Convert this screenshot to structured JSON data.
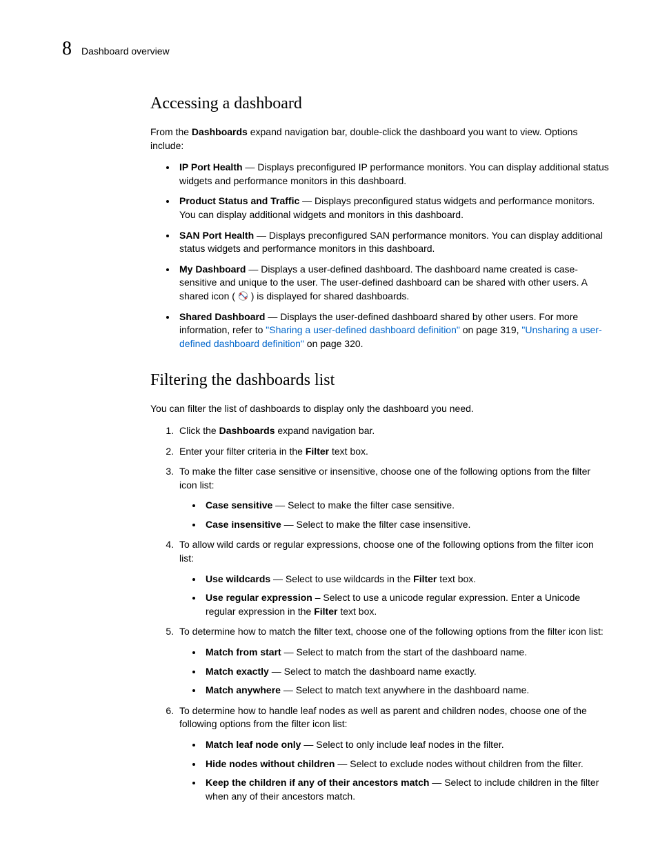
{
  "header": {
    "page_number": "8",
    "title": "Dashboard overview"
  },
  "section1": {
    "heading": "Accessing a dashboard",
    "intro_a": "From the ",
    "intro_bold": "Dashboards",
    "intro_b": " expand navigation bar, double-click the dashboard you want to view. Options include:",
    "items": [
      {
        "bold": "IP Port Health",
        "rest": " — Displays preconfigured IP performance monitors. You can display additional status widgets and performance monitors in this dashboard."
      },
      {
        "bold": "Product Status and Traffic",
        "rest": " — Displays preconfigured status widgets and performance monitors. You can display additional widgets and monitors in this dashboard."
      },
      {
        "bold": "SAN Port Health",
        "rest": " — Displays preconfigured SAN performance monitors. You can display additional status widgets and performance monitors in this dashboard."
      }
    ],
    "item4": {
      "bold": "My Dashboard",
      "rest_a": " — Displays a user-defined dashboard. The dashboard name created is case-sensitive and unique to the user. The user-defined dashboard can be shared with other users. A shared icon ( ",
      "rest_b": " ) is displayed for shared dashboards."
    },
    "item5": {
      "bold": "Shared Dashboard",
      "rest_a": " — Displays the user-defined dashboard shared by other users. For more information, refer to ",
      "link1": "\"Sharing a user-defined dashboard definition\"",
      "mid1": " on page 319, ",
      "link2": "\"Unsharing a user-defined dashboard definition\"",
      "rest_b": " on page 320."
    }
  },
  "section2": {
    "heading": "Filtering the dashboards list",
    "intro": "You can filter the list of dashboards to display only the dashboard you need.",
    "step1": {
      "a": "Click the ",
      "bold": "Dashboards",
      "b": " expand navigation bar."
    },
    "step2": {
      "a": "Enter your filter criteria in the ",
      "bold": "Filter",
      "b": " text box."
    },
    "step3": {
      "text": "To make the filter case sensitive or insensitive, choose one of the following options from the filter icon list:",
      "subs": [
        {
          "bold": "Case sensitive",
          "rest": " — Select to make the filter case sensitive."
        },
        {
          "bold": "Case insensitive",
          "rest": " — Select to make the filter case insensitive."
        }
      ]
    },
    "step4": {
      "text": "To allow wild cards or regular expressions, choose one of the following options from the filter icon list:",
      "sub1": {
        "bold": "Use wildcards",
        "a": " — Select to use wildcards in the ",
        "bold2": "Filter",
        "b": " text box."
      },
      "sub2": {
        "bold": "Use regular expression",
        "a": " – Select to use a unicode regular expression. Enter a Unicode regular expression in the ",
        "bold2": "Filter",
        "b": " text box."
      }
    },
    "step5": {
      "text": "To determine how to match the filter text, choose one of the following options from the filter icon list:",
      "subs": [
        {
          "bold": "Match from start",
          "rest": " — Select to match from the start of the dashboard name."
        },
        {
          "bold": "Match exactly",
          "rest": " — Select to match the dashboard name exactly."
        },
        {
          "bold": "Match anywhere",
          "rest": " — Select to match text anywhere in the dashboard name."
        }
      ]
    },
    "step6": {
      "text": "To determine how to handle leaf nodes as well as parent and children nodes, choose one of the following options from the filter icon list:",
      "subs": [
        {
          "bold": "Match leaf node only",
          "rest": " — Select to only include leaf nodes in the filter."
        },
        {
          "bold": "Hide nodes without children",
          "rest": " — Select to exclude nodes without children from the filter."
        },
        {
          "bold": "Keep the children if any of their ancestors match",
          "rest": " — Select to include children in the filter when any of their ancestors match."
        }
      ]
    }
  }
}
